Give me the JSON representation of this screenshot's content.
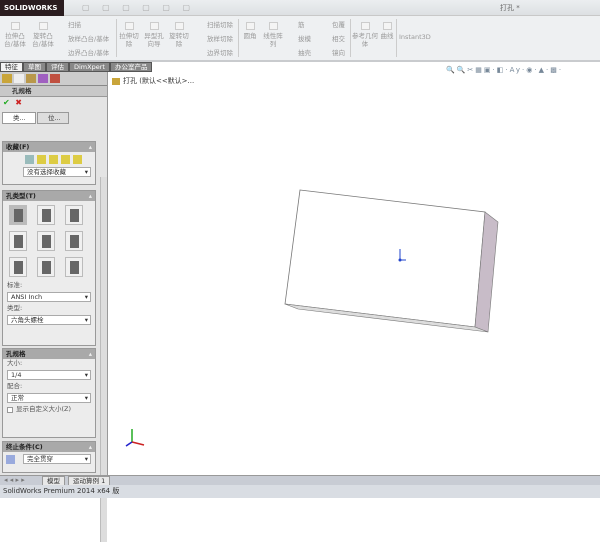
{
  "app": {
    "logo": "SOLIDWORKS",
    "doc_title": "打孔 *",
    "qat": "▢ ▢ ▢ ▢ ▢ ▢"
  },
  "ribbon": {
    "extrude_boss": "拉伸凸台/基体",
    "revolve_boss": "旋转凸台/基体",
    "sweep": "扫描",
    "loft_boss": "放样凸台/基体",
    "boundary_boss": "边界凸台/基体",
    "extrude_cut": "拉伸切除",
    "hole_wizard": "异型孔向导",
    "revolve_cut": "旋转切除",
    "sweep_cut": "扫描切除",
    "loft_cut": "放样切除",
    "boundary_cut": "边界切除",
    "fillet": "圆角",
    "linear_pattern": "线性阵列",
    "rib": "筋",
    "draft": "拔模",
    "shell": "抽壳",
    "wrap": "包覆",
    "intersect": "相交",
    "mirror": "镜向",
    "ref_geometry": "参考几何体",
    "curves": "曲线",
    "instant3d": "Instant3D"
  },
  "tabs": [
    {
      "label": "特征",
      "active": true
    },
    {
      "label": "草图"
    },
    {
      "label": "评估"
    },
    {
      "label": "DimXpert"
    },
    {
      "label": "办公室产品"
    }
  ],
  "tree": {
    "item": "打孔 (默认<<默认>..."
  },
  "panel": {
    "title": "孔规格",
    "ok": "✔",
    "cancel": "✖",
    "subtabs": [
      "类...",
      "位..."
    ],
    "favorites": {
      "header": "收藏(F)",
      "select": "没有选择收藏"
    },
    "hole_type": {
      "header": "孔类型(T)",
      "standard_label": "标准:",
      "standard": "ANSI Inch",
      "type_label": "类型:",
      "type": "六角头螺栓"
    },
    "hole_spec": {
      "header": "孔规格",
      "size_label": "大小:",
      "size": "1/4",
      "fit_label": "配合:",
      "fit": "正常",
      "custom_size": "显示自定义大小(Z)"
    },
    "end_condition": {
      "header": "终止条件(C)",
      "value": "完全贯穿"
    }
  },
  "bottom_tabs": [
    "模型",
    "运动算例 1"
  ],
  "status": "SolidWorks Premium 2014 x64 版",
  "colors": {
    "accent": "#2a1c1f",
    "panel_header": "#a9a9a9"
  }
}
